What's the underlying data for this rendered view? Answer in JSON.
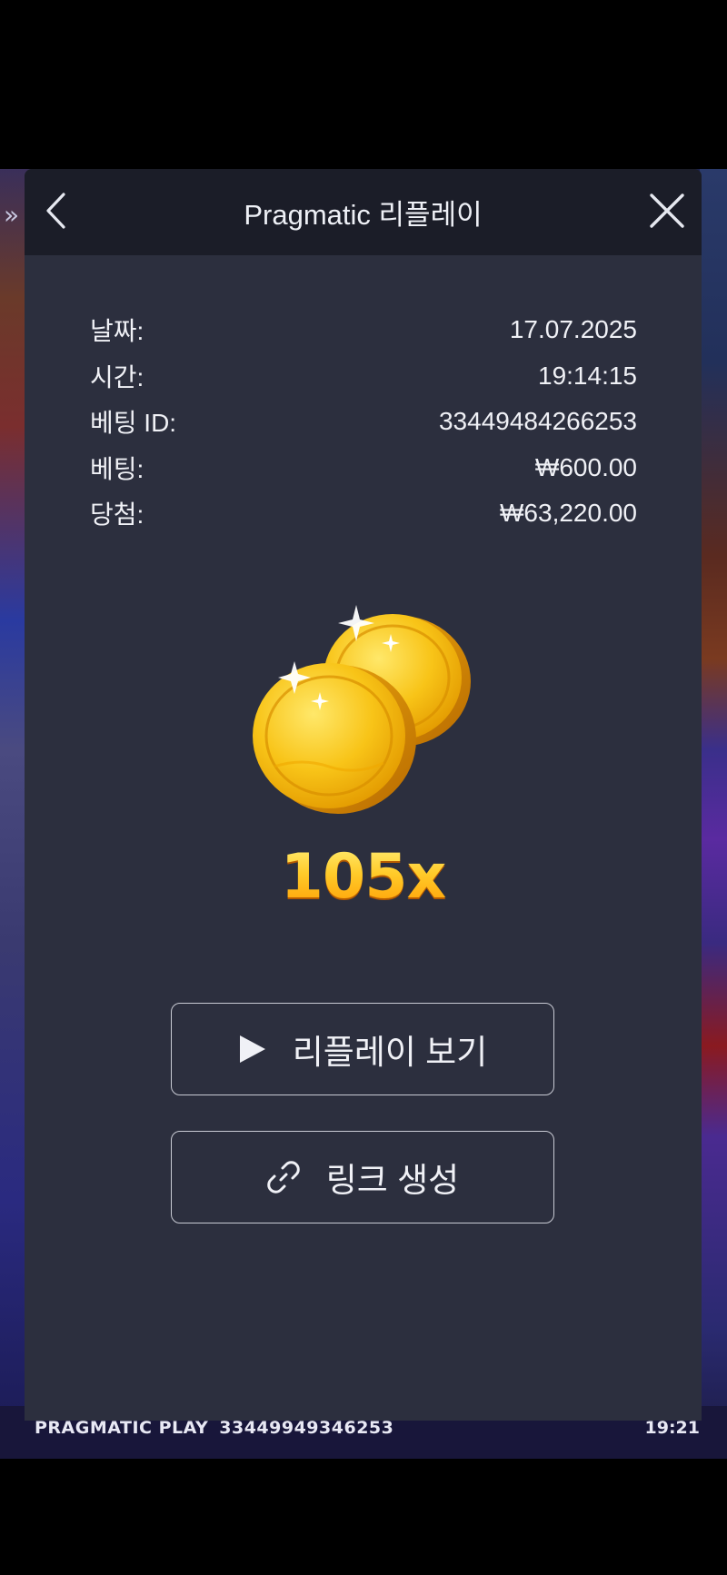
{
  "header": {
    "title": "Pragmatic 리플레이"
  },
  "info": {
    "rows": [
      {
        "label": "날짜:",
        "value": "17.07.2025"
      },
      {
        "label": "시간:",
        "value": "19:14:15"
      },
      {
        "label": "베팅 ID:",
        "value": "33449484266253"
      },
      {
        "label": "베팅:",
        "value": "₩600.00"
      },
      {
        "label": "당첨:",
        "value": "₩63,220.00"
      }
    ]
  },
  "result": {
    "multiplier": "105x"
  },
  "actions": {
    "replay_label": "리플레이 보기",
    "link_label": "링크 생성"
  },
  "footer": {
    "brand": "PRAGMATIC PLAY",
    "round_id": "33449949346253",
    "time": "19:21"
  },
  "icons": {
    "back": "chevron-left-icon",
    "close": "close-icon",
    "play": "play-icon",
    "link": "link-icon",
    "coins": "gold-coins-icon"
  },
  "colors": {
    "modal_bg": "#2c2f3e",
    "header_bg": "#1b1d28",
    "multiplier_gold": "#ffb01a"
  }
}
